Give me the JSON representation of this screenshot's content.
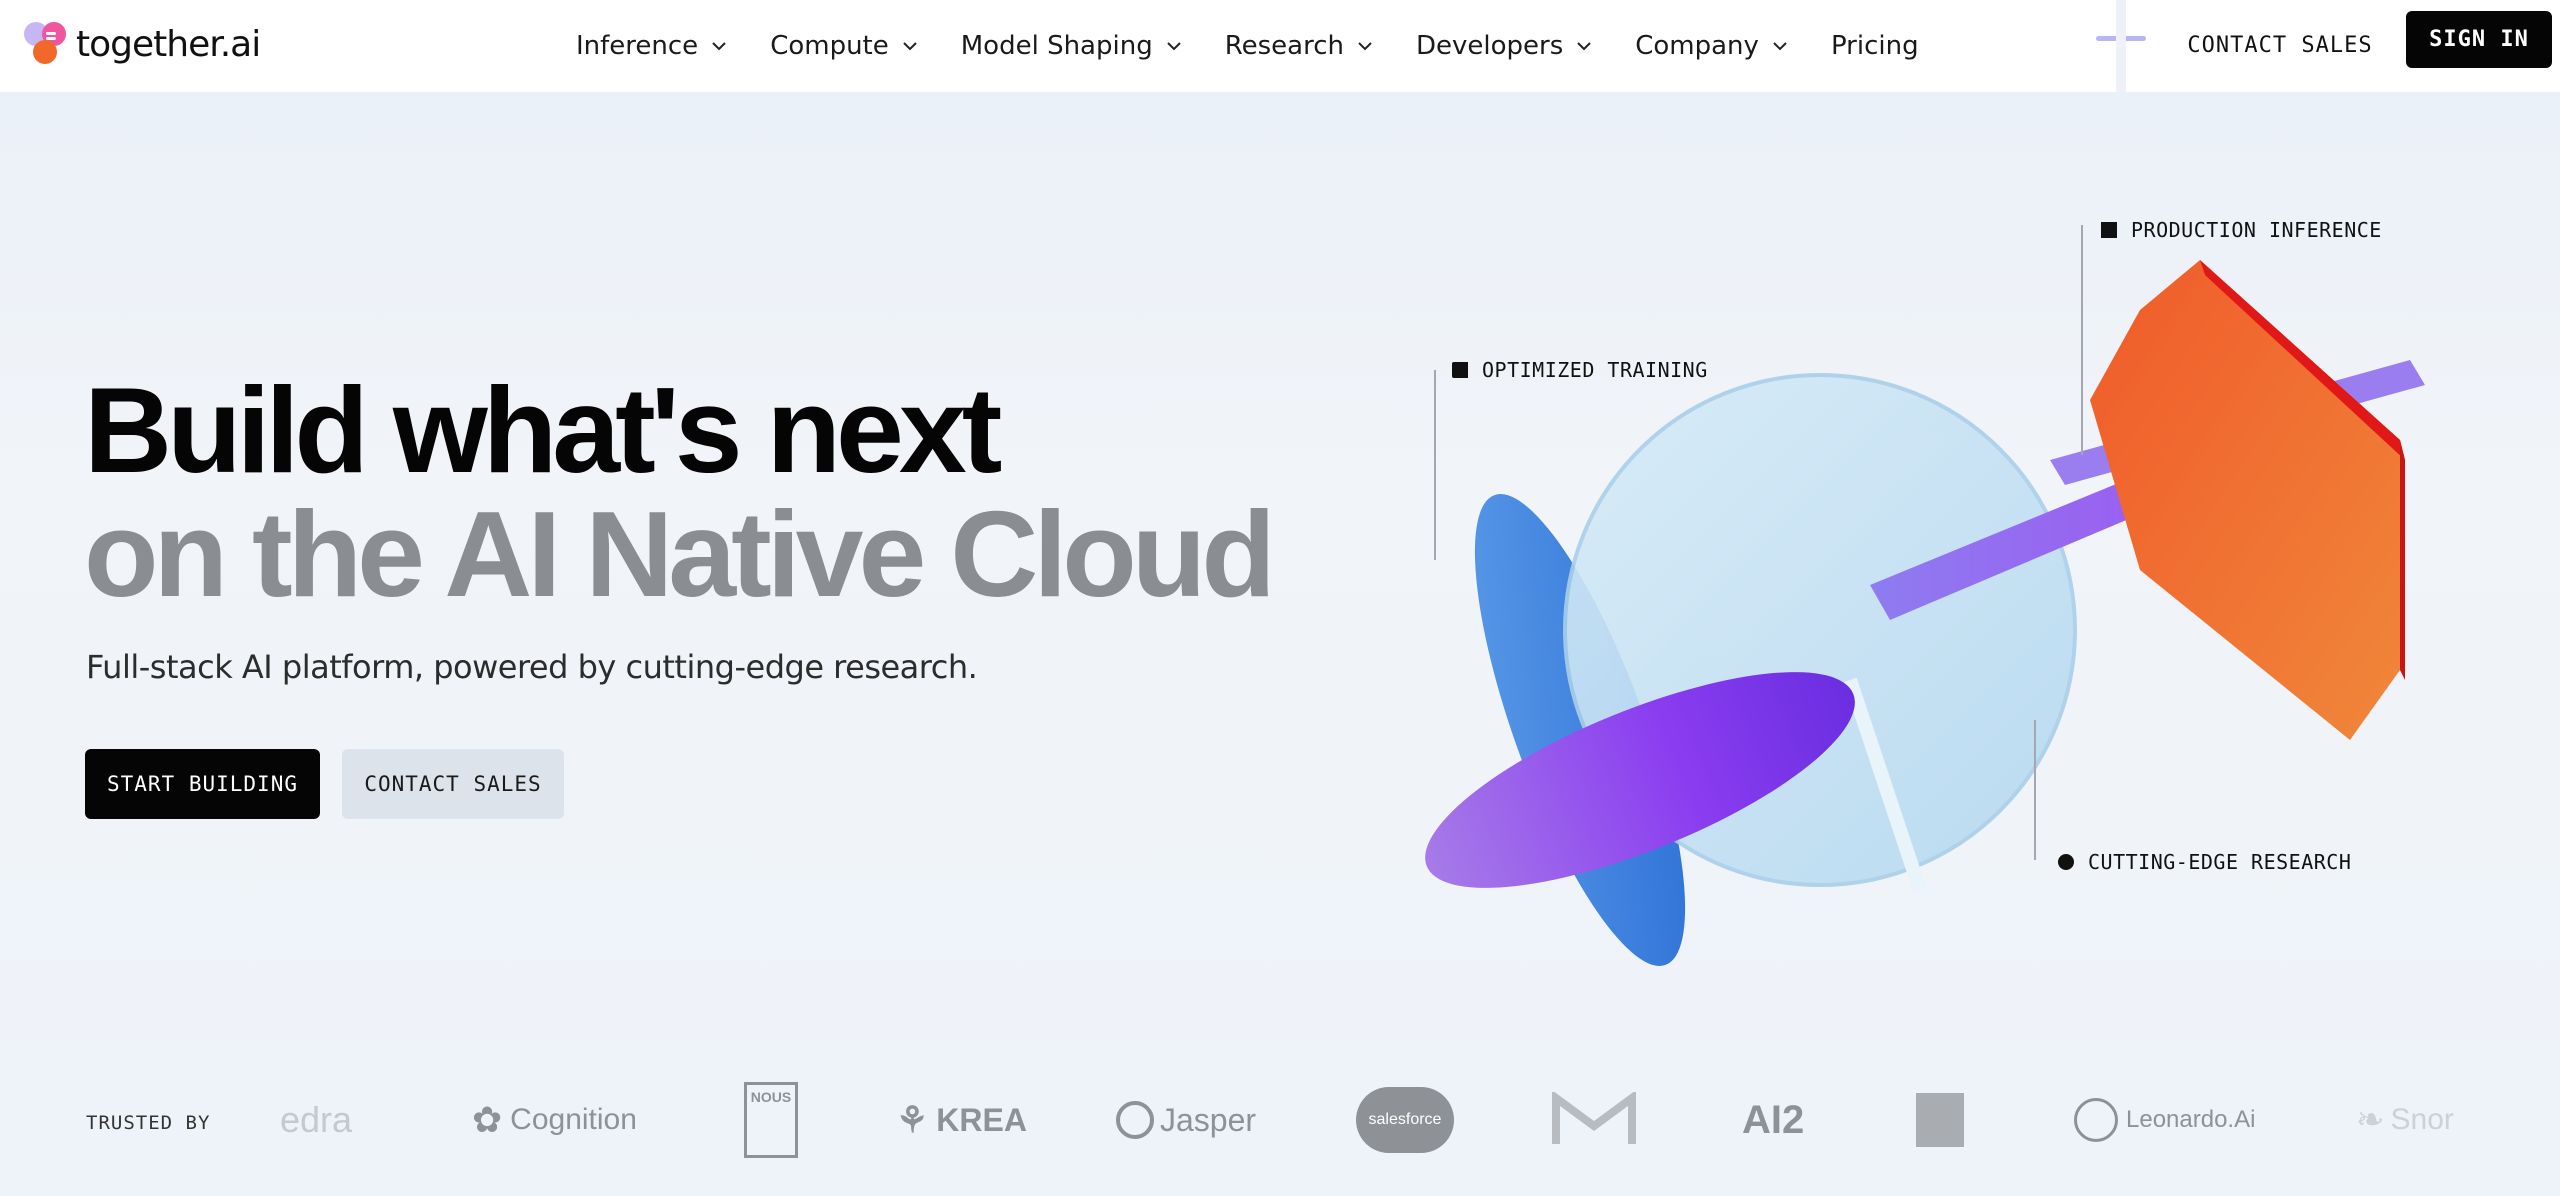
{
  "header": {
    "brand": "together.ai",
    "nav": [
      {
        "label": "Inference",
        "has_dropdown": true
      },
      {
        "label": "Compute",
        "has_dropdown": true
      },
      {
        "label": "Model Shaping",
        "has_dropdown": true
      },
      {
        "label": "Research",
        "has_dropdown": true
      },
      {
        "label": "Developers",
        "has_dropdown": true
      },
      {
        "label": "Company",
        "has_dropdown": true
      },
      {
        "label": "Pricing",
        "has_dropdown": false
      }
    ],
    "contact_sales": "CONTACT SALES",
    "sign_in": "SIGN IN"
  },
  "hero": {
    "title_line1": "Build what's next",
    "title_line2": "on the AI Native Cloud",
    "subtitle": "Full-stack AI platform, powered by cutting-edge research.",
    "cta_primary": "START BUILDING",
    "cta_secondary": "CONTACT SALES"
  },
  "illustration": {
    "labels": {
      "training": "OPTIMIZED TRAINING",
      "inference": "PRODUCTION INFERENCE",
      "research": "CUTTING-EDGE RESEARCH"
    }
  },
  "trusted": {
    "label": "TRUSTED BY",
    "logos": [
      "edra",
      "Cognition",
      "NOUS",
      "KREA",
      "Jasper",
      "salesforce",
      "AI2",
      "Leonardo.Ai",
      "Snor"
    ]
  },
  "colors": {
    "accent_dark": "#050505",
    "muted_title": "#8a8d91",
    "secondary_button": "#dde3ea",
    "logo_gray": "#8e9196"
  }
}
